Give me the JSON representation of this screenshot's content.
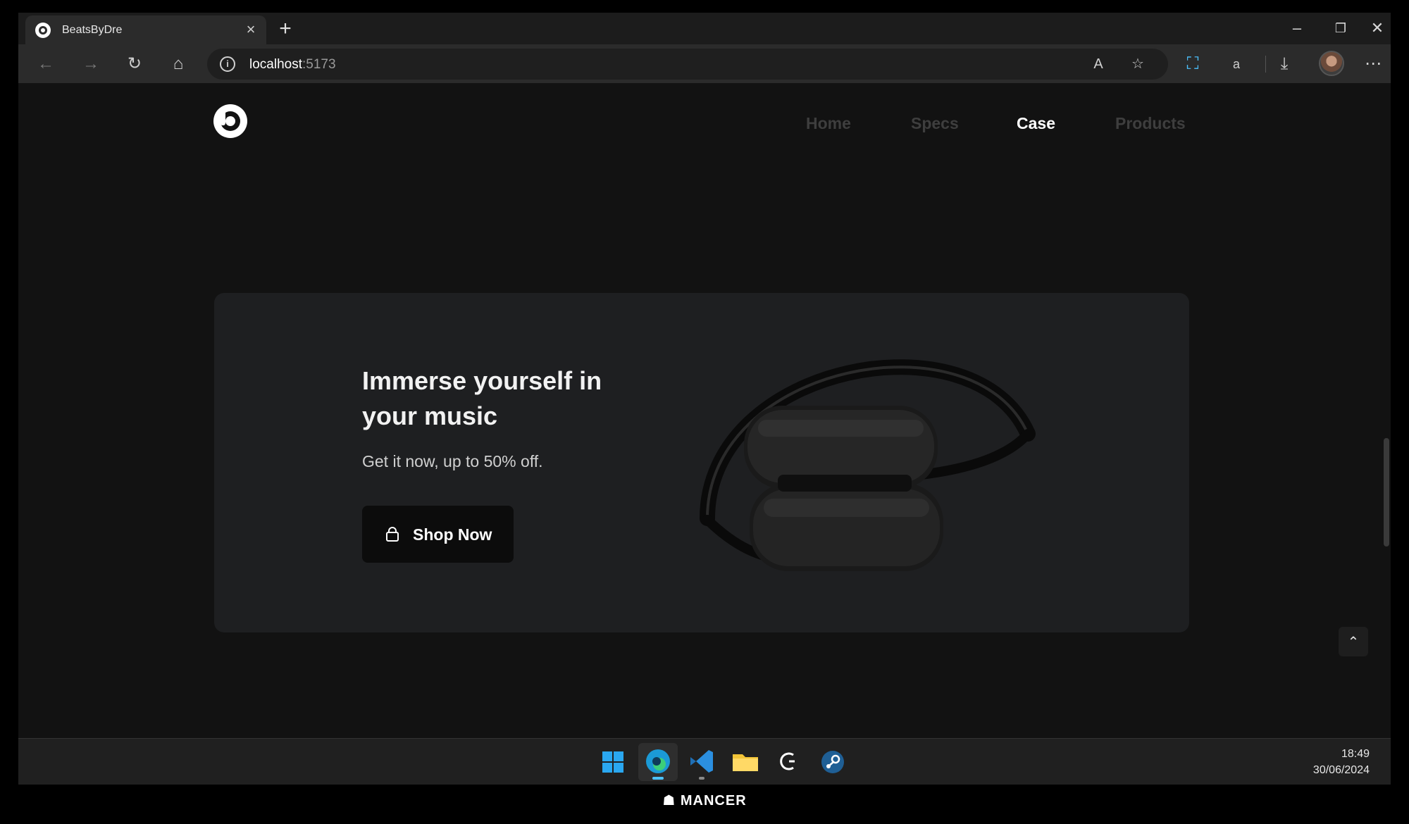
{
  "browser": {
    "tab_title": "BeatsByDre",
    "url_host": "localhost",
    "url_port": ":5173"
  },
  "site": {
    "nav": [
      {
        "label": "Home",
        "active": false
      },
      {
        "label": "Specs",
        "active": false
      },
      {
        "label": "Case",
        "active": true
      },
      {
        "label": "Products",
        "active": false
      }
    ],
    "hero": {
      "title": "Immerse yourself in your music",
      "subtitle": "Get it now, up to 50% off.",
      "cta_label": "Shop Now"
    }
  },
  "taskbar": {
    "time": "18:49",
    "date": "30/06/2024"
  },
  "watermark": "MANCER"
}
